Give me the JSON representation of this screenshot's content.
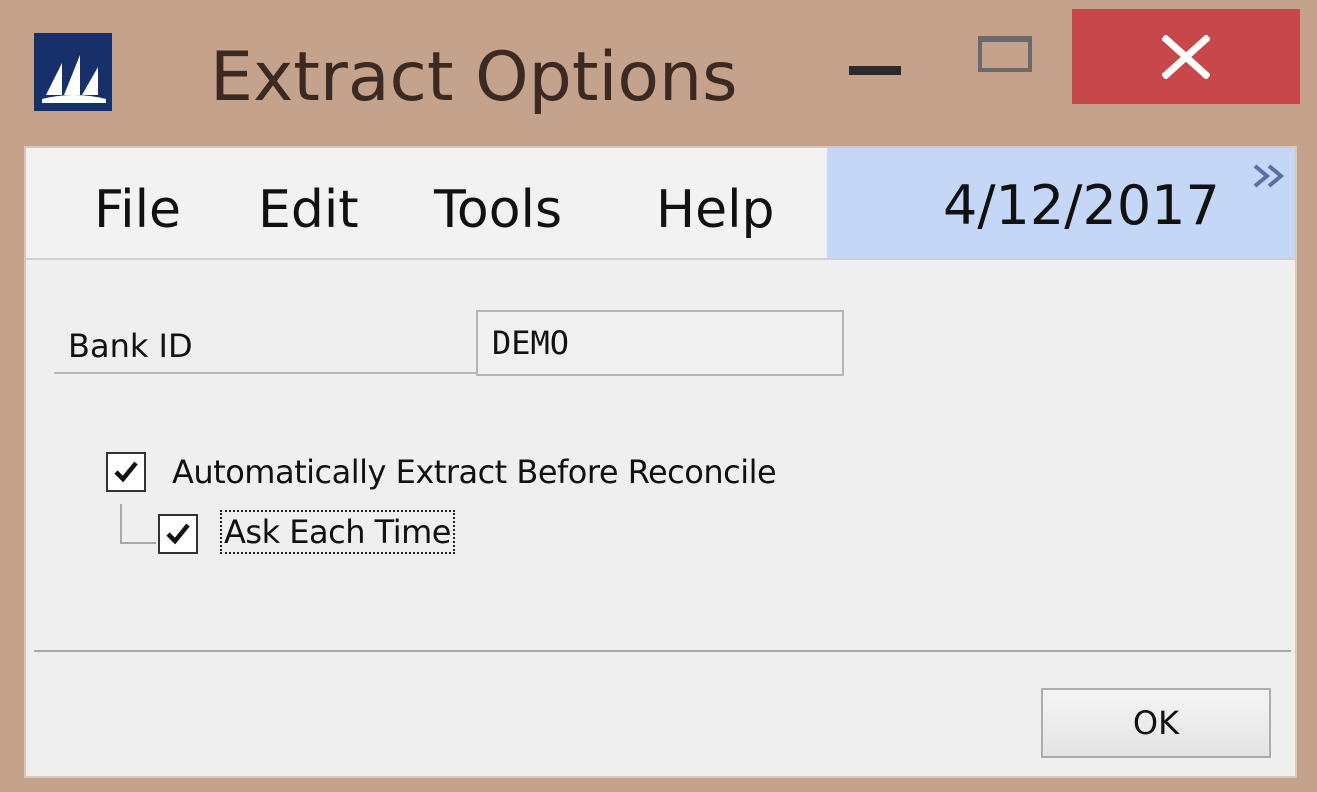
{
  "window": {
    "title": "Extract Options",
    "app_icon": "dynamics-gp-logo-icon",
    "controls": {
      "minimize_icon": "minimize-icon",
      "maximize_icon": "maximize-icon",
      "close_icon": "close-icon",
      "close_color": "#c8474a"
    }
  },
  "menubar": {
    "items": [
      {
        "label": "File"
      },
      {
        "label": "Edit"
      },
      {
        "label": "Tools"
      },
      {
        "label": "Help"
      }
    ],
    "date": "4/12/2017",
    "date_panel_color": "#c4d7f7",
    "expand_icon": "double-chevron-right-icon"
  },
  "form": {
    "bank_id": {
      "label": "Bank ID",
      "value": "DEMO"
    },
    "auto_extract": {
      "label": "Automatically Extract Before Reconcile",
      "checked": true
    },
    "ask_each_time": {
      "label": "Ask Each Time",
      "checked": true
    }
  },
  "footer": {
    "ok_label": "OK"
  }
}
